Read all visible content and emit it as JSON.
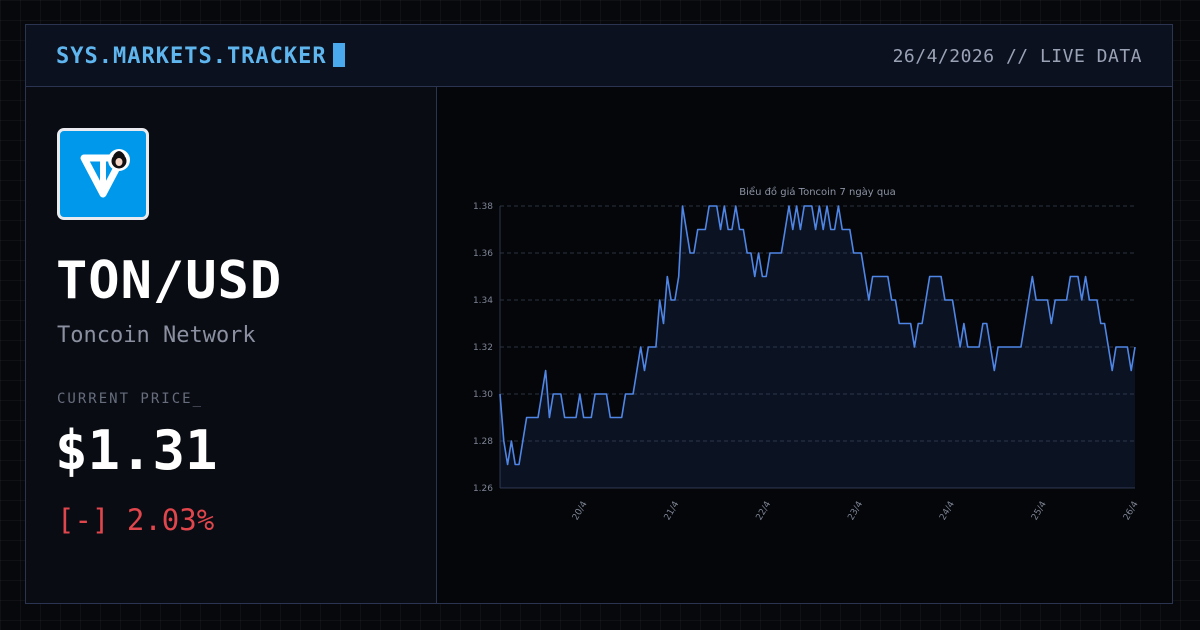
{
  "header": {
    "brand": "SYS.MARKETS.TRACKER",
    "status": "26/4/2026 // LIVE DATA"
  },
  "asset": {
    "pair": "TON/USD",
    "network": "Toncoin Network",
    "price_label": "CURRENT PRICE_",
    "price": "$1.31",
    "change_sign": "[-]",
    "change_value": "2.03%",
    "logo_icon": "toncoin-logo-icon"
  },
  "colors": {
    "accent": "#5fb6ee",
    "line": "#4f86e6",
    "negative": "#e0464b",
    "logo_bg": "#0098ea"
  },
  "chart_data": {
    "type": "line",
    "title": "Biểu đồ giá Toncoin 7 ngày qua",
    "xlabel": "",
    "ylabel": "",
    "ylim": [
      1.26,
      1.38
    ],
    "yticks": [
      "1.26",
      "1.28",
      "1.30",
      "1.32",
      "1.34",
      "1.36",
      "1.38"
    ],
    "xticks": [
      "20/4",
      "21/4",
      "22/4",
      "23/4",
      "24/4",
      "25/4",
      "26/4"
    ],
    "grid": true,
    "series": [
      {
        "values": [
          1.3,
          1.28,
          1.27,
          1.28,
          1.27,
          1.27,
          1.28,
          1.29,
          1.29,
          1.29,
          1.29,
          1.3,
          1.31,
          1.29,
          1.3,
          1.3,
          1.3,
          1.29,
          1.29,
          1.29,
          1.29,
          1.3,
          1.29,
          1.29,
          1.29,
          1.3,
          1.3,
          1.3,
          1.3,
          1.29,
          1.29,
          1.29,
          1.29,
          1.3,
          1.3,
          1.3,
          1.31,
          1.32,
          1.31,
          1.32,
          1.32,
          1.32,
          1.34,
          1.33,
          1.35,
          1.34,
          1.34,
          1.35,
          1.38,
          1.37,
          1.36,
          1.36,
          1.37,
          1.37,
          1.37,
          1.38,
          1.38,
          1.38,
          1.37,
          1.38,
          1.37,
          1.37,
          1.38,
          1.37,
          1.37,
          1.36,
          1.36,
          1.35,
          1.36,
          1.35,
          1.35,
          1.36,
          1.36,
          1.36,
          1.36,
          1.37,
          1.38,
          1.37,
          1.38,
          1.37,
          1.38,
          1.38,
          1.38,
          1.37,
          1.38,
          1.37,
          1.38,
          1.37,
          1.37,
          1.38,
          1.37,
          1.37,
          1.37,
          1.36,
          1.36,
          1.36,
          1.35,
          1.34,
          1.35,
          1.35,
          1.35,
          1.35,
          1.35,
          1.34,
          1.34,
          1.33,
          1.33,
          1.33,
          1.33,
          1.32,
          1.33,
          1.33,
          1.34,
          1.35,
          1.35,
          1.35,
          1.35,
          1.34,
          1.34,
          1.34,
          1.33,
          1.32,
          1.33,
          1.32,
          1.32,
          1.32,
          1.32,
          1.33,
          1.33,
          1.32,
          1.31,
          1.32,
          1.32,
          1.32,
          1.32,
          1.32,
          1.32,
          1.32,
          1.33,
          1.34,
          1.35,
          1.34,
          1.34,
          1.34,
          1.34,
          1.33,
          1.34,
          1.34,
          1.34,
          1.34,
          1.35,
          1.35,
          1.35,
          1.34,
          1.35,
          1.34,
          1.34,
          1.34,
          1.33,
          1.33,
          1.32,
          1.31,
          1.32,
          1.32,
          1.32,
          1.32,
          1.31,
          1.32
        ]
      }
    ]
  }
}
